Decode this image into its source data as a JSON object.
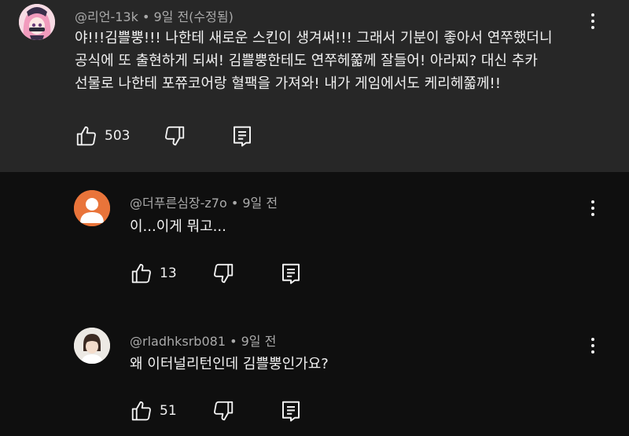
{
  "comment": {
    "handle": "@리언-13k",
    "time": "9일 전(수정됨)",
    "lines": [
      "야!!!김쁠뿡!!! 나한테 새로운 스킨이 생겨써!!! 그래서 기분이 좋아서 연쭈했더니",
      "공식에 또 출현하게 되써! 김쁠뿡한테도 연쭈헤쭓께 잘들어! 아라찌? 대신 추카",
      "선물로 나한테 포쮸코어랑 혈팩을 가져와! 내가 게임에서도 케리헤쭓께!!"
    ],
    "likes": "503"
  },
  "replies": [
    {
      "handle": "@더푸른심장-z7o",
      "time": "9일 전",
      "text": "이...이게 뭐고...",
      "likes": "13"
    },
    {
      "handle": "@rladhksrb081",
      "time": "9일 전",
      "text": "왜 이터널리턴인데 김쁠뿡인가요?",
      "likes": "51"
    }
  ],
  "separator": "•",
  "colors": {
    "main_bg": "#272727",
    "page_bg": "#0f0f0f",
    "meta_text": "#aaaaaa",
    "avatar_orange": "#e9743a"
  },
  "icons": [
    "thumb-up-icon",
    "thumb-down-icon",
    "reply-icon",
    "more-vert-icon"
  ]
}
